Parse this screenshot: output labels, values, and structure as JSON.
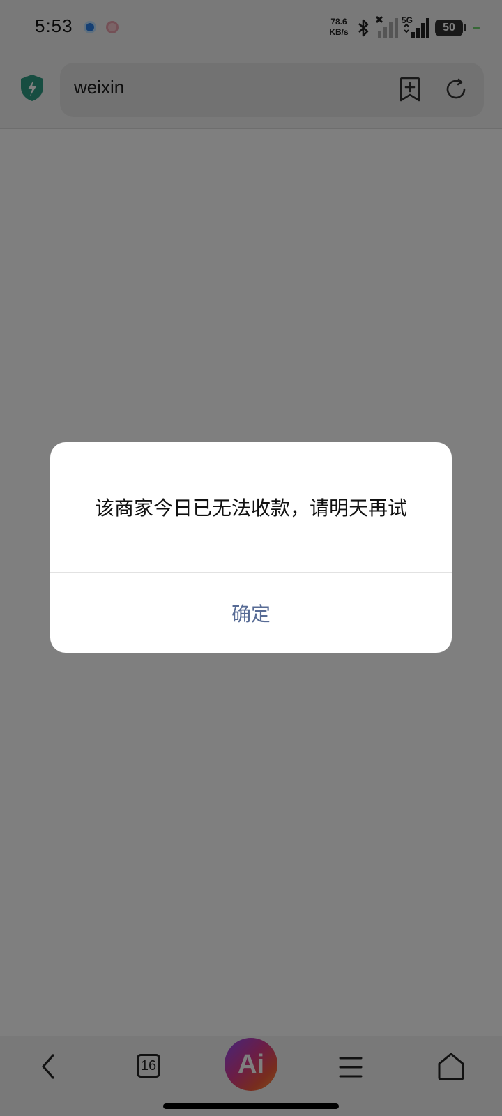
{
  "status_bar": {
    "time": "5:53",
    "net_speed_value": "78.6",
    "net_speed_unit": "KB/s",
    "network_type": "5G",
    "battery_level": "50"
  },
  "browser": {
    "address": "weixin",
    "tab_count": "16",
    "ai_label": "Ai"
  },
  "dialog": {
    "message": "该商家今日已无法收款，请明天再试",
    "confirm_label": "确定"
  },
  "colors": {
    "dialog_button": "#576b95",
    "shield": "#2f9a82",
    "overlay": "rgba(0,0,0,0.50)"
  },
  "icons": {
    "shield": "shield-icon",
    "bookmark_add": "bookmark-add-icon",
    "reload": "reload-icon",
    "back": "back-icon",
    "tabs": "tabs-icon",
    "menu": "menu-icon",
    "home": "home-icon"
  }
}
